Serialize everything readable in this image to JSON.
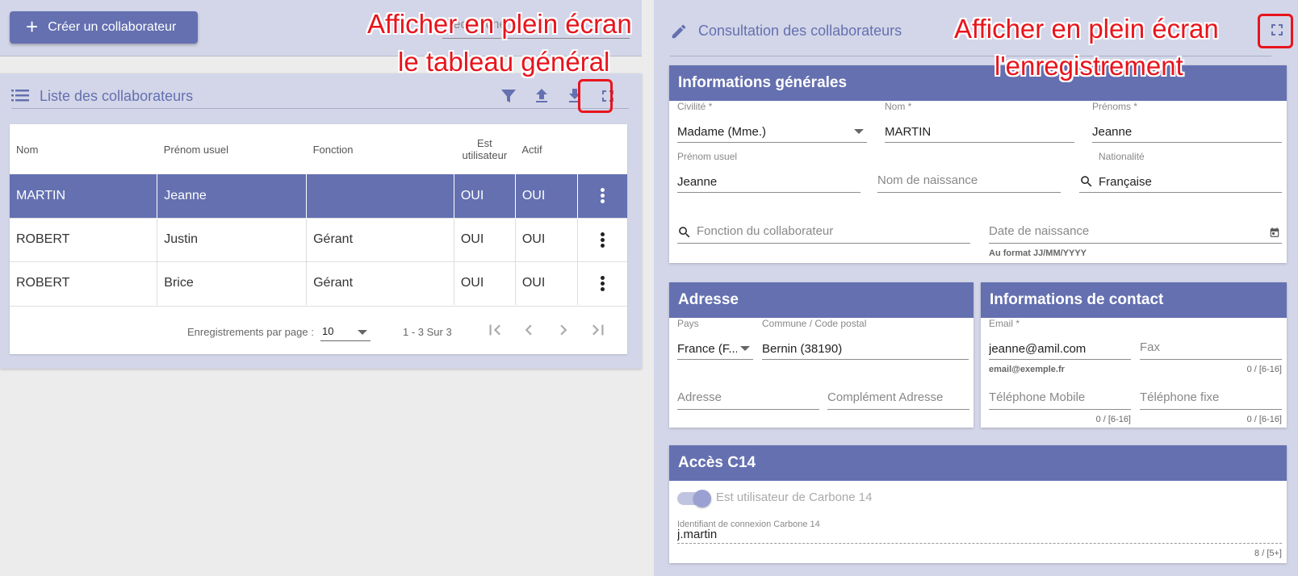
{
  "toolbar": {
    "create_label": "Créer un collaborateur",
    "search_placeholder": "Recherche rapide"
  },
  "list": {
    "title": "Liste des collaborateurs",
    "columns": [
      "Nom",
      "Prénom usuel",
      "Fonction",
      "Est utilisateur",
      "Actif"
    ],
    "rows": [
      {
        "nom": "MARTIN",
        "prenom": "Jeanne",
        "fonction": "",
        "utilisateur": "OUI",
        "actif": "OUI"
      },
      {
        "nom": "ROBERT",
        "prenom": "Justin",
        "fonction": "Gérant",
        "utilisateur": "OUI",
        "actif": "OUI"
      },
      {
        "nom": "ROBERT",
        "prenom": "Brice",
        "fonction": "Gérant",
        "utilisateur": "OUI",
        "actif": "OUI"
      }
    ],
    "selected_row": 0,
    "paginator": {
      "label": "Enregistrements par page :",
      "page_size": "10",
      "range": "1 - 3 Sur 3"
    }
  },
  "record": {
    "title": "Consultation des collaborateurs",
    "general": {
      "heading": "Informations générales",
      "civilite_label": "Civilité *",
      "civilite_value": "Madame (Mme.)",
      "nom_label": "Nom *",
      "nom_value": "MARTIN",
      "prenoms_label": "Prénoms *",
      "prenoms_value": "Jeanne",
      "prenom_usuel_label": "Prénom usuel",
      "prenom_usuel_value": "Jeanne",
      "nom_naissance_placeholder": "Nom de naissance",
      "nationalite_label": "Nationalité",
      "nationalite_value": "Française",
      "fonction_placeholder": "Fonction du collaborateur",
      "date_naissance_placeholder": "Date de naissance",
      "date_hint": "Au format JJ/MM/YYYY"
    },
    "address": {
      "heading": "Adresse",
      "pays_label": "Pays",
      "pays_value": "France (F...",
      "commune_label": "Commune / Code postal",
      "commune_value": "Bernin (38190)",
      "adresse_placeholder": "Adresse",
      "complement_placeholder": "Complément Adresse"
    },
    "contact": {
      "heading": "Informations de contact",
      "email_label": "Email *",
      "email_value": "jeanne@amil.com",
      "email_hint": "email@exemple.fr",
      "fax_placeholder": "Fax",
      "fax_count": "0 / [6-16]",
      "mobile_placeholder": "Téléphone Mobile",
      "mobile_count": "0 / [6-16]",
      "fixe_placeholder": "Téléphone fixe",
      "fixe_count": "0 / [6-16]"
    },
    "access": {
      "heading": "Accès C14",
      "toggle_label": "Est utilisateur de Carbone 14",
      "toggle_on": true,
      "login_label": "Identifiant de connexion Carbone 14",
      "login_value": "j.martin",
      "login_count": "8 / [5+]"
    }
  },
  "annotations": {
    "left_line1": "Afficher en plein écran",
    "left_line2": "le tableau général",
    "right_line1": "Afficher en plein écran",
    "right_line2": "l'enregistrement"
  },
  "colors": {
    "primary": "#6470b0",
    "panel": "#d3d6e8",
    "annotation": "#e8141c"
  },
  "icons": [
    "plus-icon",
    "list-icon",
    "filter-icon",
    "upload-icon",
    "download-icon",
    "fullscreen-icon",
    "pencil-icon",
    "search-icon",
    "calendar-icon",
    "kebab-icon",
    "first-page-icon",
    "prev-page-icon",
    "next-page-icon",
    "last-page-icon"
  ]
}
